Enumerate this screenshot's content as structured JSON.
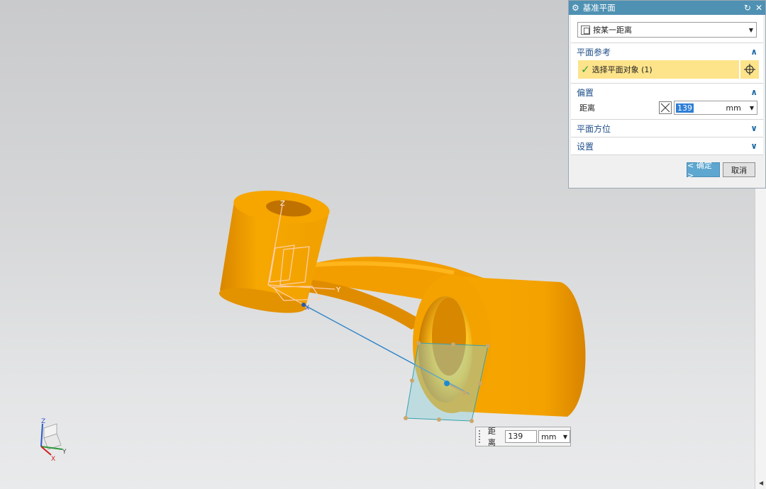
{
  "dialog": {
    "title": "基准平面",
    "type_value": "按某一距离",
    "groups": {
      "plane_ref": {
        "label": "平面参考",
        "select_text": "选择平面对象 (1)"
      },
      "offset": {
        "label": "偏置",
        "distance_label": "距离",
        "distance_value": "139",
        "unit": "mm"
      },
      "orientation": {
        "label": "平面方位"
      },
      "settings": {
        "label": "设置"
      }
    },
    "ok_label": "< 确定 >",
    "cancel_label": "取消"
  },
  "dim_box": {
    "label": "距离",
    "value": "139",
    "unit": "mm"
  },
  "axes": {
    "z": "Z",
    "y": "Y",
    "x": "X"
  },
  "triad": {
    "z": "Z",
    "y": "Y",
    "x": "X"
  },
  "colors": {
    "part": "#f5a300",
    "titlebar": "#4f91b3",
    "highlight": "#fde38a"
  }
}
